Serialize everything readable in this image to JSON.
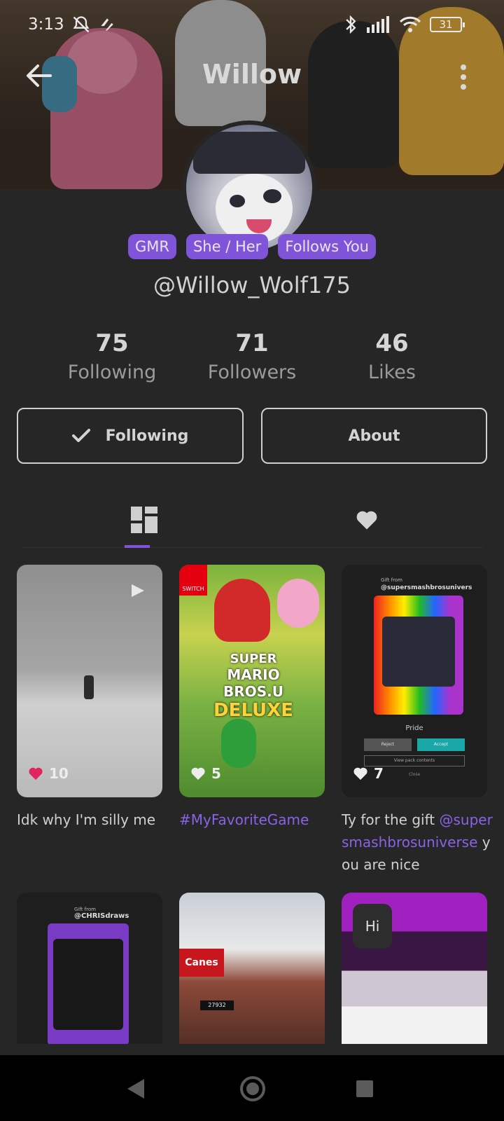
{
  "status_bar": {
    "time": "3:13",
    "battery": "31",
    "icons": [
      "mute-icon",
      "signal-app-icon",
      "bluetooth-icon",
      "cell-signal-icon",
      "wifi-icon",
      "battery-icon"
    ]
  },
  "header": {
    "title": "Willow",
    "back_icon": "arrow-left-icon",
    "more_icon": "more-vert-icon"
  },
  "profile": {
    "tags": [
      "GMR",
      "She / Her",
      "Follows You"
    ],
    "handle": "@Willow_Wolf175",
    "stats": [
      {
        "value": "75",
        "label": "Following"
      },
      {
        "value": "71",
        "label": "Followers"
      },
      {
        "value": "46",
        "label": "Likes"
      }
    ]
  },
  "actions": {
    "following_label": "Following",
    "about_label": "About"
  },
  "tabs": {
    "items": [
      "grid-icon",
      "heart-icon"
    ],
    "active": 0
  },
  "posts": [
    {
      "likes": "10",
      "caption_plain": "Idk why I'm silly me",
      "liked": true
    },
    {
      "likes": "5",
      "caption_tag": "#MyFavoriteGame",
      "liked": false
    },
    {
      "likes": "7",
      "caption_pre": "Ty for the gift ",
      "caption_mention": "@supersmashbrosuniverse",
      "caption_post": " you are nice",
      "liked": false
    }
  ],
  "post_thumbnails": {
    "post2_art_text_1": "SUPER",
    "post2_art_text_2": "MARIO BROS.U",
    "post2_art_text_3": "DELUXE",
    "post2_switch": "SWITCH",
    "post3_gift_from": "Gift from",
    "post3_user": "@supersmashbrosunivers",
    "post3_pack": "Pride",
    "post3_reject": "Reject",
    "post3_accept": "Accept",
    "post3_view": "View pack contents",
    "post3_close": "Close",
    "post4_gift_from": "Gift from",
    "post4_user": "@CHRISdraws",
    "post5_sign": "Canes",
    "post5_number": "27932",
    "post6_label": "Hi"
  },
  "colors": {
    "accent": "#7f54d8",
    "background": "#262626",
    "like_red": "#e0245e"
  }
}
